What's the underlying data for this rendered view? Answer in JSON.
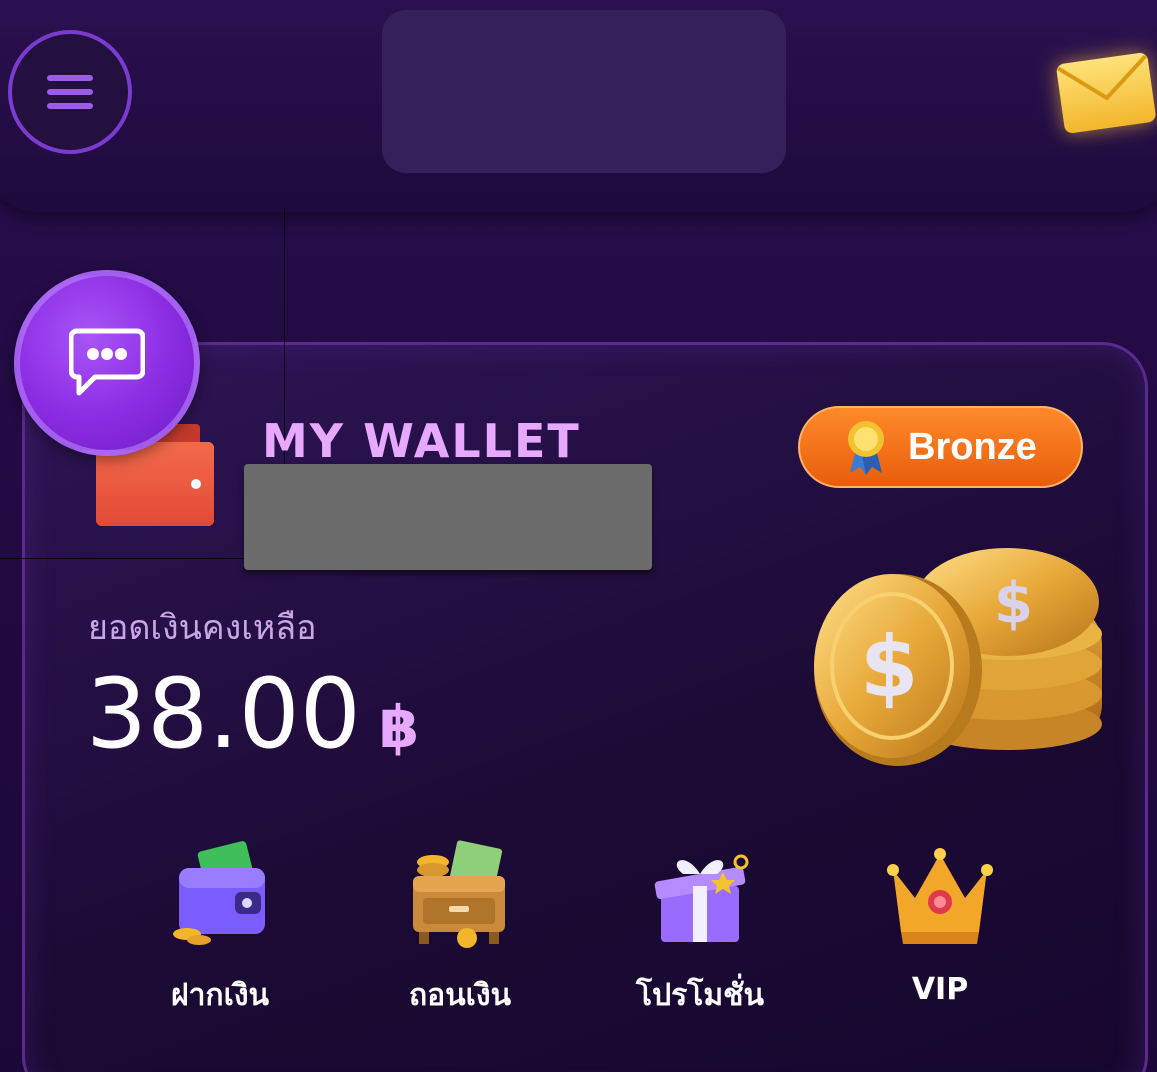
{
  "header": {
    "menu_icon": "hamburger-menu-icon",
    "mail_icon": "envelope-icon"
  },
  "chat": {
    "icon": "chat-bubble-icon"
  },
  "wallet": {
    "title": "MY WALLET",
    "tier": "Bronze",
    "balance_label": "ยอดเงินคงเหลือ",
    "balance": "38.00",
    "currency": "฿"
  },
  "actions": [
    {
      "label": "ฝากเงิน",
      "icon": "wallet-deposit-icon"
    },
    {
      "label": "ถอนเงิน",
      "icon": "drawer-withdraw-icon"
    },
    {
      "label": "โปรโมชั่น",
      "icon": "gift-box-icon"
    },
    {
      "label": "VIP",
      "icon": "crown-icon"
    }
  ],
  "colors": {
    "accent": "#e7a9ff",
    "badge": "#f07418",
    "background": "#220a44"
  }
}
